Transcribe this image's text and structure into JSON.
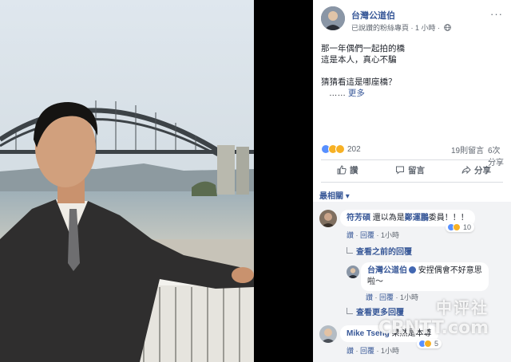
{
  "post": {
    "page_name": "台灣公道伯",
    "meta_text": "已說讚的粉絲專頁 · 1 小時 ·",
    "more_icon": "ellipsis-icon",
    "privacy_icon": "globe-icon",
    "lines": [
      "那一年偶們一起拍的橋",
      "這是本人，真心不騙",
      "",
      "猜猜看這是哪座橋？"
    ],
    "ellipsis": "……",
    "see_more": "更多"
  },
  "stats": {
    "reaction_count": "202",
    "reaction_icons": [
      "like-icon",
      "haha-icon",
      "wow-icon"
    ],
    "comments": "19則留言",
    "shares": "6次分享"
  },
  "actions": {
    "like": "讚",
    "comment": "留言",
    "share": "分享"
  },
  "sort_label": "最相關",
  "comments": [
    {
      "author": "符芳碩",
      "text": "還以為是",
      "link_text": "鄭運鵬",
      "text_after": "委員！！！",
      "like": "讚",
      "reply": "回覆",
      "time": "1小時",
      "reactions": "10"
    }
  ],
  "view_previous": "查看之前的回覆",
  "reply": {
    "author": "台灣公道伯",
    "text_line1": "安捏偶會不好意思",
    "text_line2": "啦～",
    "like": "讚",
    "reply": "回覆",
    "time": "1小時"
  },
  "view_more_replies": "查看更多回覆",
  "comment2": {
    "author": "Mike Tseng",
    "text": "果然是本尊",
    "like": "讚",
    "reply": "回覆",
    "time": "1小時",
    "reactions": "5"
  },
  "watermark": {
    "cn": "中评社",
    "en": "CRNTT.com"
  },
  "colors": {
    "link": "#385898",
    "like_blue": "#5890ff",
    "haha_yellow": "#f7b125",
    "comment_bg": "#f2f3f5"
  }
}
